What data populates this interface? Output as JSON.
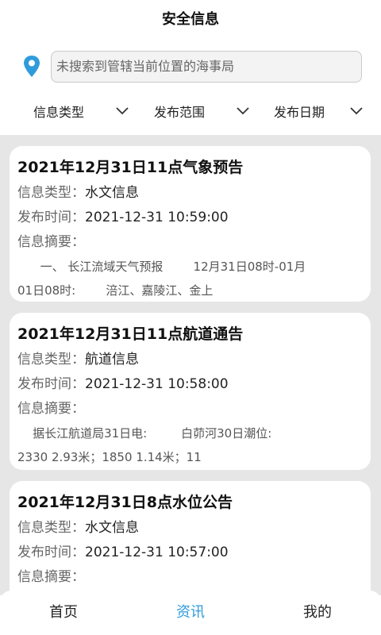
{
  "header": {
    "title": "安全信息",
    "search_placeholder": "未搜索到管辖当前位置的海事局"
  },
  "filters": [
    {
      "label": "信息类型"
    },
    {
      "label": "发布范围"
    },
    {
      "label": "发布日期"
    }
  ],
  "field_labels": {
    "type": "信息类型：",
    "time": "发布时间：",
    "summary": "信息摘要："
  },
  "cards": [
    {
      "title": "2021年12月31日11点气象预告",
      "type": "水文信息",
      "time": "2021-12-31 10:59:00",
      "summary_line1": "      一、 长江流域天气预报        12月31日08时-01月",
      "summary_line2": "01日08时:        涪江、嘉陵江、金上"
    },
    {
      "title": "2021年12月31日11点航道通告",
      "type": "航道信息",
      "time": "2021-12-31 10:58:00",
      "summary_line1": "    据长江航道局31日电:         白茆河30日潮位:",
      "summary_line2": "2330 2.93米；1850 1.14米；11"
    },
    {
      "title": "2021年12月31日8点水位公告",
      "type": "水文信息",
      "time": "2021-12-31 10:57:00",
      "summary_line1": "",
      "summary_line2": ""
    }
  ],
  "nav": {
    "home": "首页",
    "news": "资讯",
    "mine": "我的",
    "active_color": "#2f9bdc"
  },
  "colors": {
    "location_icon": "#2f9bdc",
    "content_bg": "#e6e6e6"
  },
  "icons": {
    "location": "location-pin-icon",
    "dropdown": "chevron-down-icon"
  }
}
